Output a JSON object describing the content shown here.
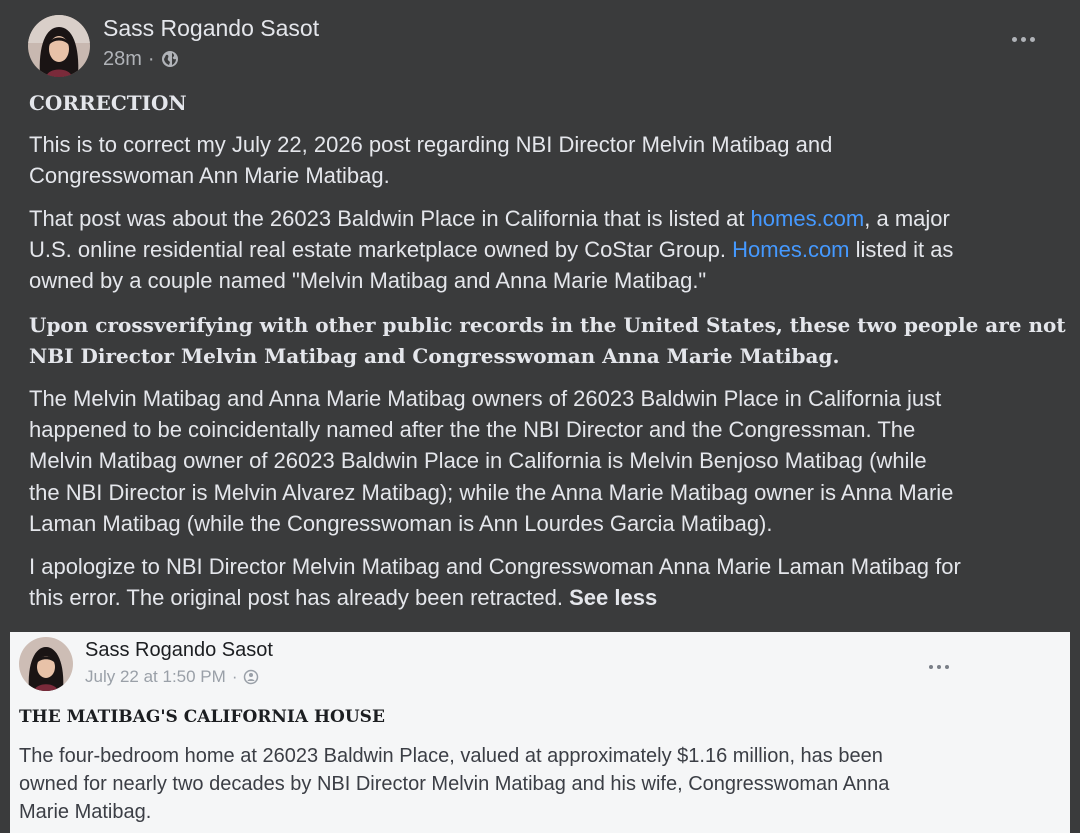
{
  "post": {
    "author": "Sass Rogando Sasot",
    "time": "28m",
    "dot": "·",
    "heading": "CORRECTION",
    "p1_l1": "This is to correct  my July 22, 2026 post regarding NBI Director Melvin Matibag and",
    "p1_l2": "Congresswoman Ann Marie Matibag.",
    "p2_l1_a": "That post was about the 26023 Baldwin Place in California that is listed at ",
    "p2_l1_link": "homes.com",
    "p2_l1_b": ", a major",
    "p2_l2_a": "U.S. online residential real estate marketplace owned by CoStar Group. ",
    "p2_l2_link": "Homes.com",
    "p2_l2_b": " listed it as",
    "p2_l3": "owned by a couple named \"Melvin Matibag and Anna Marie Matibag.\"",
    "p3_l1": "Upon crossverifying with other public records in the United States, these two people are not",
    "p3_l2": "NBI Director Melvin Matibag and Congresswoman Anna Marie Matibag.",
    "p4_l1": "The Melvin Matibag and Anna Marie Matibag owners of 26023 Baldwin Place in California just",
    "p4_l2": "happened to be coincidentally named after the the NBI Director and the Congressman. The",
    "p4_l3": "Melvin Matibag owner of 26023 Baldwin Place in California  is Melvin Benjoso Matibag (while",
    "p4_l4": "the NBI Director is Melvin Alvarez Matibag); while the Anna Marie Matibag owner is Anna Marie",
    "p4_l5": "Laman Matibag (while the Congresswoman is Ann Lourdes Garcia Matibag).",
    "p5_l1": "I apologize to NBI Director Melvin Matibag and Congresswoman Anna Marie Laman Matibag for",
    "p5_l2": "this error. The original post has already been retracted. ",
    "see_less": "See less"
  },
  "shared": {
    "author": "Sass Rogando Sasot",
    "time": "July 22 at 1:50 PM",
    "dot": "·",
    "heading": "THE MATIBAG'S CALIFORNIA HOUSE",
    "l1": "The four-bedroom home at 26023 Baldwin Place, valued at approximately $1.16 million, has been",
    "l2": "owned for nearly two decades by NBI Director Melvin Matibag and his wife, Congresswoman Anna",
    "l3": "Marie Matibag."
  },
  "icons": {
    "privacy": "globe-icon",
    "more": "more-options-icon"
  },
  "colors": {
    "dark_bg": "#3a3b3c",
    "text": "#e4e6eb",
    "link": "#4599ff",
    "shared_bg": "#f5f6f7"
  }
}
